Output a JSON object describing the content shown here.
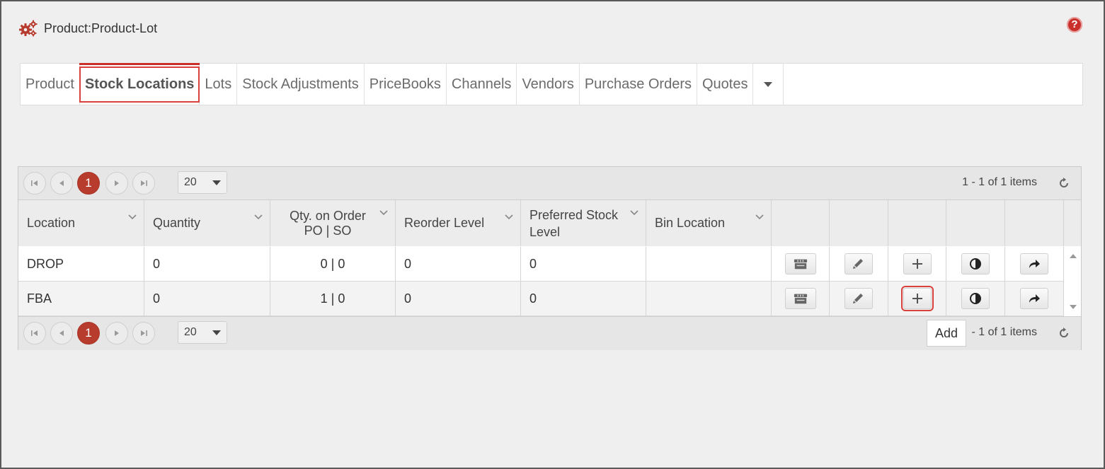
{
  "window": {
    "title": "Product:Product-Lot",
    "help_label": "?"
  },
  "tabs": [
    {
      "label": "Product",
      "active": false
    },
    {
      "label": "Stock Locations",
      "active": true
    },
    {
      "label": "Lots",
      "active": false
    },
    {
      "label": "Stock Adjustments",
      "active": false
    },
    {
      "label": "PriceBooks",
      "active": false
    },
    {
      "label": "Channels",
      "active": false
    },
    {
      "label": "Vendors",
      "active": false
    },
    {
      "label": "Purchase Orders",
      "active": false
    },
    {
      "label": "Quotes",
      "active": false
    }
  ],
  "pager": {
    "current_page": "1",
    "page_size": "20",
    "items_info_top": "1 - 1 of 1 items",
    "items_info_bottom": "- 1 of 1 items"
  },
  "columns": [
    {
      "label": "Location"
    },
    {
      "label": "Quantity"
    },
    {
      "label": "Qty. on Order\nPO | SO"
    },
    {
      "label": "Reorder Level"
    },
    {
      "label": "Preferred Stock\nLevel"
    },
    {
      "label": "Bin Location"
    }
  ],
  "rows": [
    {
      "location": "DROP",
      "quantity": "0",
      "on_order": "0 | 0",
      "reorder": "0",
      "preferred": "0",
      "bin": ""
    },
    {
      "location": "FBA",
      "quantity": "0",
      "on_order": "1 | 0",
      "reorder": "0",
      "preferred": "0",
      "bin": ""
    }
  ],
  "actions": [
    "warehouse-icon",
    "pencil-icon",
    "plus-icon",
    "contrast-icon",
    "share-icon"
  ],
  "tooltip": {
    "text": "Add"
  },
  "colors": {
    "accent": "#c9302c",
    "highlight": "#d9413c"
  }
}
